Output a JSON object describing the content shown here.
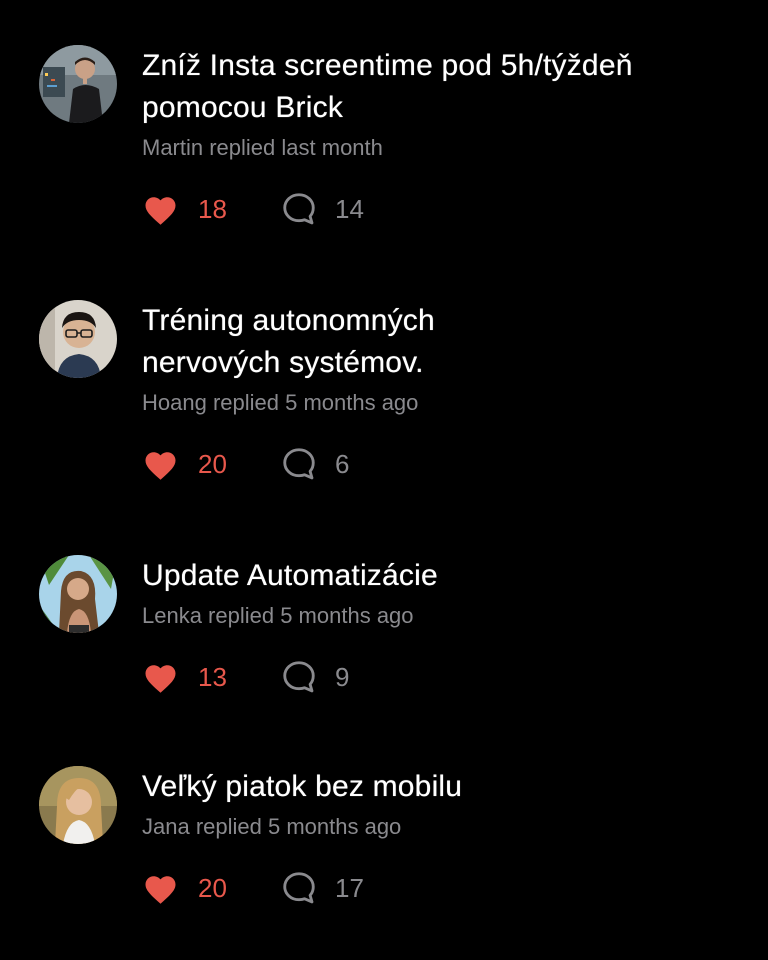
{
  "colors": {
    "background": "#000000",
    "title": "#ffffff",
    "meta": "#8a8a8e",
    "like_accent": "#e8584c",
    "comment_icon": "#8a8a8e"
  },
  "icons": {
    "like": "heart-icon",
    "comment": "comment-bubble-icon"
  },
  "threads": [
    {
      "title": "Zníž Insta screentime pod 5h/týždeň\npomocou Brick",
      "meta": "Martin replied last month",
      "likes": "18",
      "comments": "14"
    },
    {
      "title": "Tréning autonomných\nnervových systémov.",
      "meta": "Hoang replied 5 months ago",
      "likes": "20",
      "comments": "6"
    },
    {
      "title": "Update Automatizácie",
      "meta": "Lenka replied 5 months ago",
      "likes": "13",
      "comments": "9"
    },
    {
      "title": "Veľký piatok bez mobilu",
      "meta": "Jana replied 5 months ago",
      "likes": "20",
      "comments": "17"
    }
  ]
}
